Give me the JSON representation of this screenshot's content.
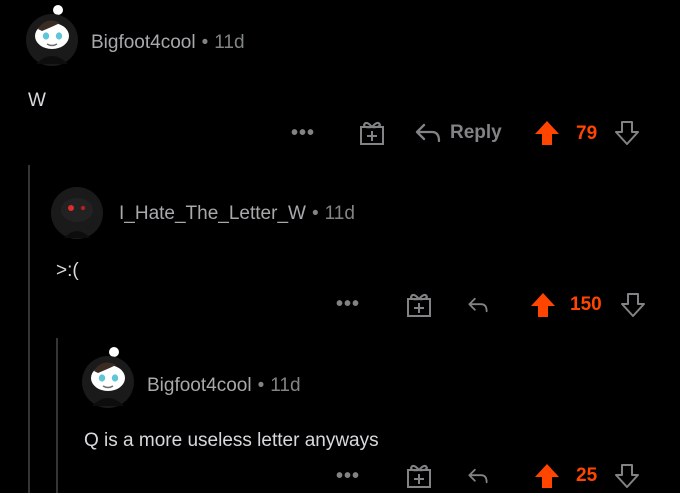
{
  "comments": [
    {
      "username": "Bigfoot4cool",
      "separator": "•",
      "age": "11d",
      "text": "W",
      "reply_label": "Reply",
      "score": "79",
      "avatar": "snoo-avatar-white-hat",
      "vote_state": "upvoted"
    },
    {
      "username": "I_Hate_The_Letter_W",
      "separator": "•",
      "age": "11d",
      "text": ">:(",
      "reply_label": "",
      "score": "150",
      "avatar": "snoo-avatar-dark",
      "vote_state": "upvoted"
    },
    {
      "username": "Bigfoot4cool",
      "separator": "•",
      "age": "11d",
      "text": "Q is a more useless letter anyways",
      "reply_label": "",
      "score": "25",
      "avatar": "snoo-avatar-white-hat",
      "vote_state": "upvoted"
    }
  ],
  "actions": {
    "more_label": "•••",
    "more_icon": "ellipsis-icon",
    "award_icon": "gift-award-icon",
    "reply_icon": "reply-arrow-icon",
    "upvote_icon": "upvote-arrow-icon",
    "downvote_icon": "downvote-arrow-icon"
  },
  "colors": {
    "background": "#000000",
    "upvote": "#ff4500",
    "muted": "#818384",
    "text": "#d7dadc",
    "thread_line": "#343536"
  }
}
